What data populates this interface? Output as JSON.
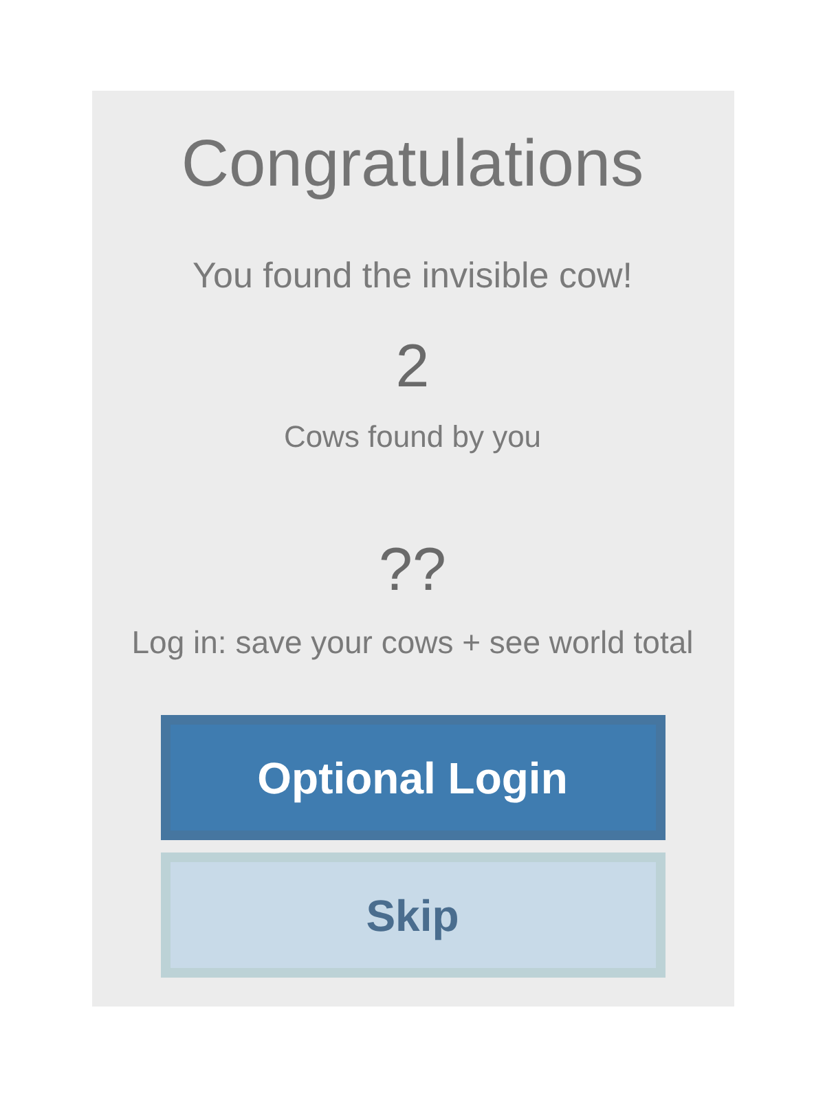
{
  "card": {
    "title": "Congratulations",
    "message": "You found the invisible cow!"
  },
  "stats": [
    {
      "value": "2",
      "label": "Cows found by you"
    },
    {
      "value": "??",
      "label": "Log in: save your cows + see world total"
    }
  ],
  "buttons": [
    {
      "label": "Optional Login",
      "kind": "primary"
    },
    {
      "label": "Skip",
      "kind": "secondary"
    }
  ]
}
